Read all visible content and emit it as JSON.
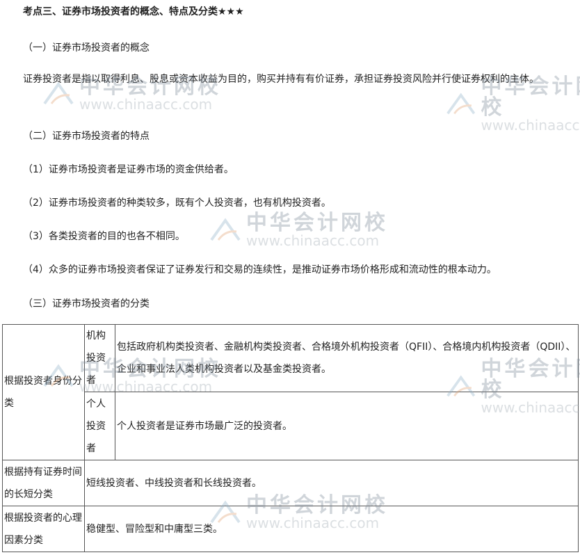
{
  "title": "考点三、证券市场投资者的概念、特点及分类★★★",
  "section1": "（一）证券市场投资者的概念",
  "definition": "证券投资者是指以取得利息、股息或资本收益为目的，购买并持有有价证券，承担证券投资风险并行使证券权利的主体。",
  "section2": "（二）证券市场投资者的特点",
  "features": [
    "（1）证券市场投资者是证券市场的资金供给者。",
    "（2）证券市场投资者的种类较多，既有个人投资者，也有机构投资者。",
    "（3）各类投资者的目的也各不相同。",
    "（4）众多的证券市场投资者保证了证券发行和交易的连续性，是推动证券市场价格形成和流动性的根本动力。"
  ],
  "section3": "（三）证券市场投资者的分类",
  "table": {
    "row1": {
      "category": "根据投资者身份分类",
      "sub": [
        {
          "type": "机构投资者",
          "desc": "包括政府机构类投资者、金融机构类投资者、合格境外机构投资者（QFII）、合格境内机构投资者（QDII）、企业和事业法人类机构投资者以及基金类投资者。"
        },
        {
          "type": "个人投资者",
          "desc": "个人投资者是证券市场最广泛的投资者。"
        }
      ]
    },
    "row2": {
      "category": "根据持有证券时间的长短分类",
      "desc": "短线投资者、中线投资者和长线投资者。"
    },
    "row3": {
      "category": "根据投资者的心理因素分类",
      "desc": "稳健型、冒险型和中庸型三类。"
    }
  },
  "watermark": {
    "cn": "中华会计网校",
    "en": "www.chinaacc.com"
  }
}
